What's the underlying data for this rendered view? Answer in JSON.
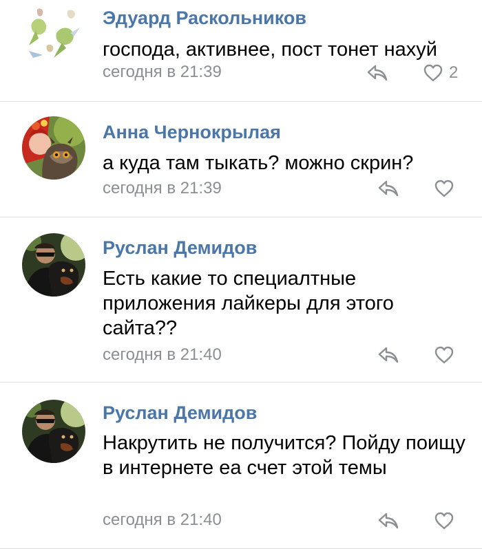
{
  "comments": [
    {
      "author": "Эдуард Раскольников",
      "text": "господа, активнее, пост тонет нахуй",
      "time": "сегодня в 21:39",
      "likes": "2"
    },
    {
      "author": "Анна Чернокрылая",
      "text": "а куда там тыкать? можно скрин?",
      "time": "сегодня в 21:39",
      "likes": ""
    },
    {
      "author": "Руслан Демидов",
      "text": "Есть какие то специалтные приложения лайкеры для этого сайта??",
      "time": "сегодня в 21:40",
      "likes": ""
    },
    {
      "author": "Руслан Демидов",
      "text": "Накрутить не получится? Пойду поищу в интернете еа счет этой темы",
      "time": "сегодня в 21:40",
      "likes": ""
    }
  ],
  "icons": {
    "reply": "reply-arrow-icon",
    "like": "heart-outline-icon"
  },
  "colors": {
    "author": "#4a76a8",
    "meta": "#8b8e93",
    "divider": "#dfe2e6"
  }
}
